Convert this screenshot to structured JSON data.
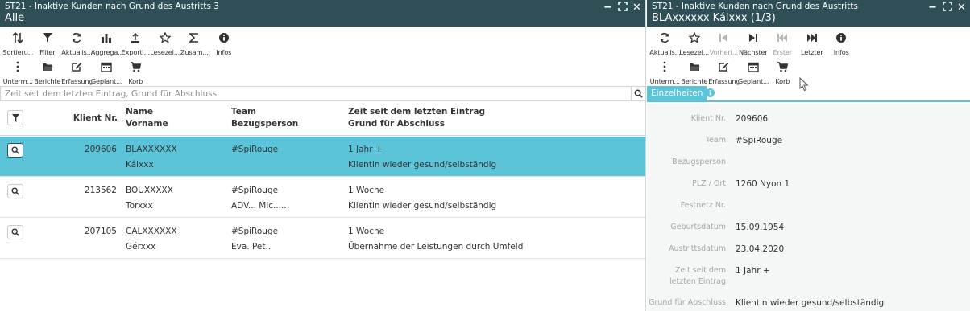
{
  "left": {
    "title": "ST21 - Inaktive Kunden nach Grund des Austritts 3",
    "subtitle": "Alle",
    "toolbar1": [
      {
        "label": "Sortieru...",
        "icon": "sort-icon"
      },
      {
        "label": "Filter",
        "icon": "filter-icon"
      },
      {
        "label": "Aktualis...",
        "icon": "refresh-icon"
      },
      {
        "label": "Aggrega...",
        "icon": "bar-chart-icon"
      },
      {
        "label": "Exporti...",
        "icon": "export-icon"
      },
      {
        "label": "Lesezei...",
        "icon": "star-icon"
      },
      {
        "label": "Zusam...",
        "icon": "sigma-icon"
      },
      {
        "label": "Infos",
        "icon": "info-icon"
      }
    ],
    "toolbar2": [
      {
        "label": "Unterm...",
        "icon": "more-vertical-icon"
      },
      {
        "label": "Berichte",
        "icon": "folder-icon"
      },
      {
        "label": "Erfassung",
        "icon": "edit-icon"
      },
      {
        "label": "Geplant...",
        "icon": "calendar-icon"
      },
      {
        "label": "Korb",
        "icon": "cart-icon"
      }
    ],
    "search_placeholder": "Zeit seit dem letzten Eintrag, Grund für Abschluss",
    "columns": {
      "klient_nr": "Klient Nr.",
      "name": "Name",
      "vorname": "Vorname",
      "team": "Team",
      "bezugsperson": "Bezugsperson",
      "zeit": "Zeit seit dem letzten Eintrag",
      "grund": "Grund für Abschluss"
    },
    "rows": [
      {
        "nr": "209606",
        "name": "BLAXXXXXX",
        "vorname": "Kálxxx",
        "team": "#SpiRouge",
        "bezugsperson": "",
        "zeit": "1 Jahr +",
        "grund": "Klientin wieder gesund/selbständig",
        "selected": true
      },
      {
        "nr": "213562",
        "name": "BOUXXXXX",
        "vorname": "Torxxx",
        "team": "#SpiRouge",
        "bezugsperson": "ADV... Mic......",
        "zeit": "1 Woche",
        "grund": "Klientin wieder gesund/selbständig",
        "selected": false
      },
      {
        "nr": "207105",
        "name": "CALXXXXXX",
        "vorname": "Gérxxx",
        "team": "#SpiRouge",
        "bezugsperson": "Eva. Pet..",
        "zeit": "1 Woche",
        "grund": "Übernahme der Leistungen durch Umfeld",
        "selected": false
      }
    ]
  },
  "right": {
    "title": "ST21 - Inaktive Kunden nach Grund des Austritts",
    "subtitle": "BLAxxxxxx Kálxxx (1/3)",
    "toolbar1": [
      {
        "label": "Aktualis...",
        "icon": "refresh-icon",
        "disabled": false
      },
      {
        "label": "Lesezei...",
        "icon": "star-icon",
        "disabled": false
      },
      {
        "label": "Vorheri...",
        "icon": "previous-icon",
        "disabled": true
      },
      {
        "label": "Nächster",
        "icon": "next-icon",
        "disabled": false
      },
      {
        "label": "Erster",
        "icon": "first-icon",
        "disabled": true
      },
      {
        "label": "Letzter",
        "icon": "last-icon",
        "disabled": false
      },
      {
        "label": "Infos",
        "icon": "info-icon",
        "disabled": false
      }
    ],
    "toolbar2": [
      {
        "label": "Unterm...",
        "icon": "more-vertical-icon"
      },
      {
        "label": "Berichte",
        "icon": "folder-icon"
      },
      {
        "label": "Erfassung",
        "icon": "edit-icon"
      },
      {
        "label": "Geplant...",
        "icon": "calendar-icon"
      },
      {
        "label": "Korb",
        "icon": "cart-icon"
      }
    ],
    "tab": "Einzelheiten",
    "fields": [
      {
        "label": "Klient Nr.",
        "value": "209606"
      },
      {
        "label": "Team",
        "value": "#SpiRouge"
      },
      {
        "label": "Bezugsperson",
        "value": ""
      },
      {
        "label": "PLZ / Ort",
        "value": "1260 Nyon 1"
      },
      {
        "label": "Festnetz Nr.",
        "value": ""
      },
      {
        "label": "Geburtsdatum",
        "value": "15.09.1954"
      },
      {
        "label": "Austrittsdatum",
        "value": "23.04.2020"
      },
      {
        "label": "Zeit seit dem letzten Eintrag",
        "value": "1 Jahr +"
      },
      {
        "label": "Grund für Abschluss",
        "value": "Klientin wieder gesund/selbständig"
      }
    ]
  },
  "colors": {
    "titlebar": "#2f4f57",
    "accent": "#5bc4d9",
    "detail_bg": "#f5f6f6"
  }
}
